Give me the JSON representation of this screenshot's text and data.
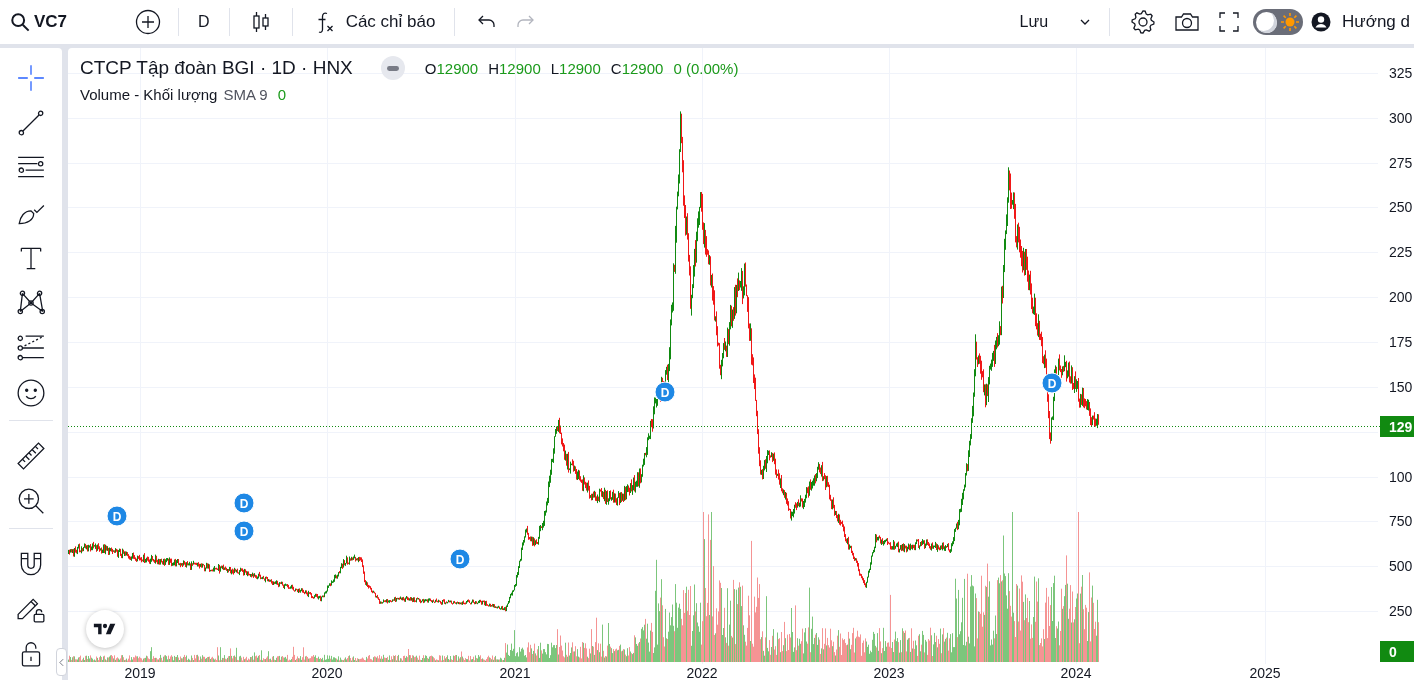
{
  "toolbar": {
    "symbol": "VC7",
    "interval": "D",
    "indicators_label": "Các chỉ báo",
    "undo": {
      "disabled": false
    },
    "redo": {
      "disabled": true
    },
    "save_label": "Lưu",
    "theme_toggle": {
      "on": false
    },
    "help_label": "Hướng d"
  },
  "drawing_toolbar": {
    "groups": [
      {
        "tools": [
          {
            "kind": "crosshair",
            "selected": true
          },
          {
            "kind": "trend-line",
            "selected": false
          },
          {
            "kind": "fib",
            "selected": false
          },
          {
            "kind": "brush",
            "selected": false
          },
          {
            "kind": "text",
            "selected": false
          },
          {
            "kind": "pattern",
            "selected": false
          },
          {
            "kind": "forecast",
            "selected": false
          },
          {
            "kind": "emoji",
            "selected": false
          }
        ]
      },
      {
        "tools": [
          {
            "kind": "ruler",
            "selected": false
          },
          {
            "kind": "zoom",
            "selected": false
          }
        ]
      },
      {
        "tools": [
          {
            "kind": "magnet",
            "selected": false
          },
          {
            "kind": "lock-drawings",
            "selected": false
          },
          {
            "kind": "unlock",
            "selected": false
          }
        ]
      }
    ]
  },
  "chart": {
    "legend": {
      "title": "CTCP Tập đoàn BGI · 1D · HNX",
      "ohlc": [
        {
          "label": "O",
          "value": "12900"
        },
        {
          "label": "H",
          "value": "12900"
        },
        {
          "label": "L",
          "value": "12900"
        },
        {
          "label": "C",
          "value": "12900"
        }
      ],
      "change": "0 (0.00%)",
      "volume_title": "Volume - Khối lượng",
      "volume_sma": "SMA 9",
      "volume_value": "0"
    },
    "markers": [
      {
        "label": "D"
      },
      {
        "label": "D"
      },
      {
        "label": "D"
      },
      {
        "label": "D"
      },
      {
        "label": "D"
      },
      {
        "label": "D"
      }
    ],
    "price_axis": {
      "ticks": [
        "325",
        "300",
        "275",
        "250",
        "225",
        "200",
        "175",
        "150",
        "100",
        "750",
        "500",
        "250"
      ],
      "last_price": "129",
      "volume_last": "0"
    },
    "time_axis": {
      "labels": [
        "2019",
        "2020",
        "2021",
        "2022",
        "2023",
        "2024",
        "2025"
      ]
    }
  }
}
